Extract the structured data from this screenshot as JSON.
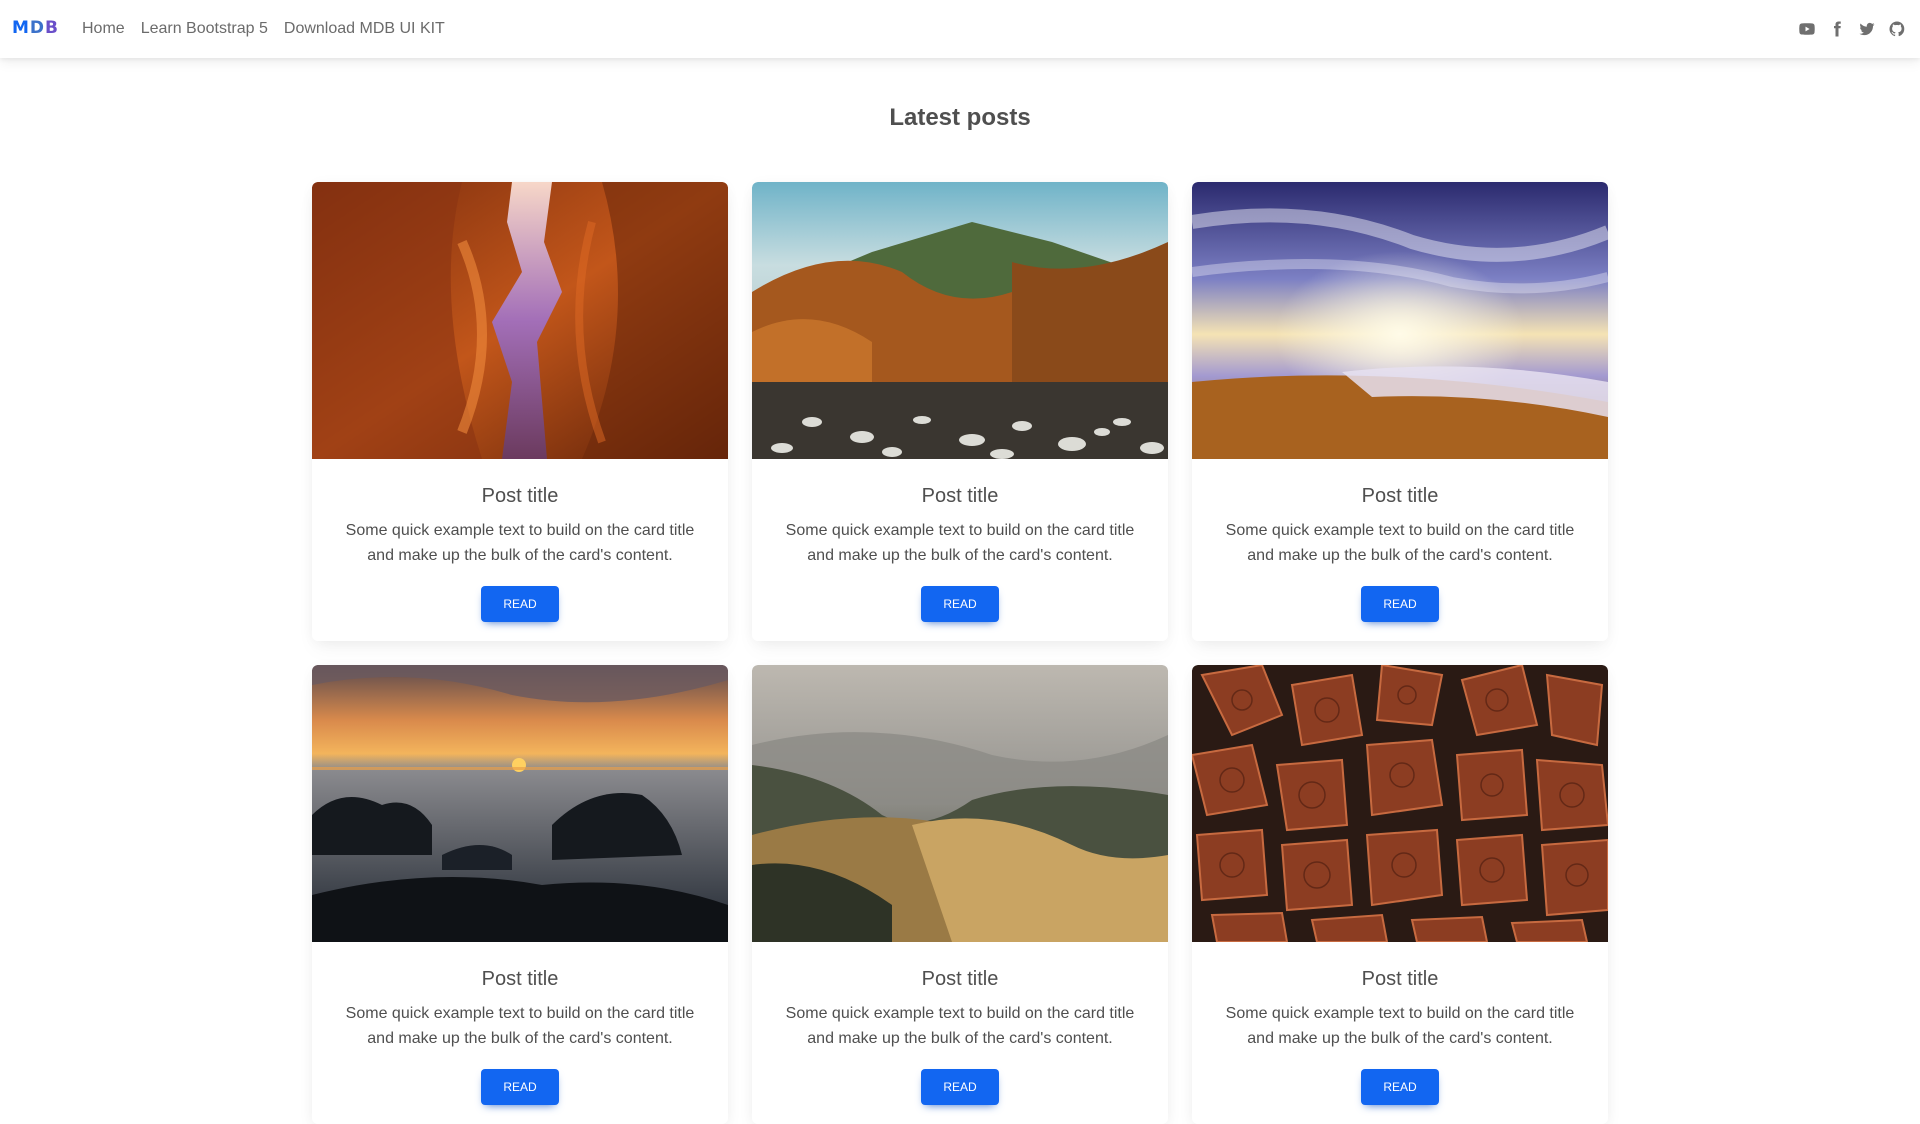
{
  "navbar": {
    "brand": {
      "part1": "M",
      "part2": "D",
      "part3": "B"
    },
    "links": [
      "Home",
      "Learn Bootstrap 5",
      "Download MDB UI KIT"
    ],
    "social_icons": [
      "youtube-icon",
      "facebook-icon",
      "twitter-icon",
      "github-icon"
    ]
  },
  "page": {
    "heading": "Latest posts"
  },
  "posts": [
    {
      "image": "canyon-photo",
      "title": "Post title",
      "text": "Some quick example text to build on the card title and make up the bulk of the card's content.",
      "button": "Read"
    },
    {
      "image": "autumn-forest-river-photo",
      "title": "Post title",
      "text": "Some quick example text to build on the card title and make up the bulk of the card's content.",
      "button": "Read"
    },
    {
      "image": "beach-sunset-photo",
      "title": "Post title",
      "text": "Some quick example text to build on the card title and make up the bulk of the card's content.",
      "button": "Read"
    },
    {
      "image": "sea-rocks-sunset-photo",
      "title": "Post title",
      "text": "Some quick example text to build on the card title and make up the bulk of the card's content.",
      "button": "Read"
    },
    {
      "image": "misty-hills-photo",
      "title": "Post title",
      "text": "Some quick example text to build on the card title and make up the bulk of the card's content.",
      "button": "Read"
    },
    {
      "image": "firewood-logs-photo",
      "title": "Post title",
      "text": "Some quick example text to build on the card title and make up the bulk of the card's content.",
      "button": "Read"
    }
  ],
  "colors": {
    "primary": "#1266f1",
    "text": "#4f4f4f",
    "nav_text": "#6b6b6b",
    "background": "#ffffff"
  }
}
